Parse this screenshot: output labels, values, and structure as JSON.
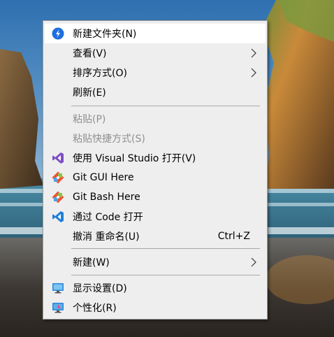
{
  "menu": {
    "items": [
      {
        "label": "新建文件夹(N)",
        "icon": "new-folder-icon"
      },
      {
        "label": "查看(V)"
      },
      {
        "label": "排序方式(O)"
      },
      {
        "label": "刷新(E)"
      },
      {
        "label": "粘贴(P)",
        "disabled": true
      },
      {
        "label": "粘贴快捷方式(S)",
        "disabled": true
      },
      {
        "label": "使用 Visual Studio 打开(V)",
        "icon": "visual-studio-icon"
      },
      {
        "label": "Git GUI Here",
        "icon": "git-gui-icon"
      },
      {
        "label": "Git Bash Here",
        "icon": "git-bash-icon"
      },
      {
        "label": "通过 Code 打开",
        "icon": "vscode-icon"
      },
      {
        "label": "撤消 重命名(U)",
        "shortcut": "Ctrl+Z"
      },
      {
        "label": "新建(W)"
      },
      {
        "label": "显示设置(D)",
        "icon": "display-settings-icon"
      },
      {
        "label": "个性化(R)",
        "icon": "personalize-icon"
      }
    ]
  },
  "colors": {
    "menu_bg": "#eeeeee",
    "highlight_bg": "#ffffff",
    "disabled_text": "#8f8f8f",
    "separator": "#a9a9a9"
  }
}
